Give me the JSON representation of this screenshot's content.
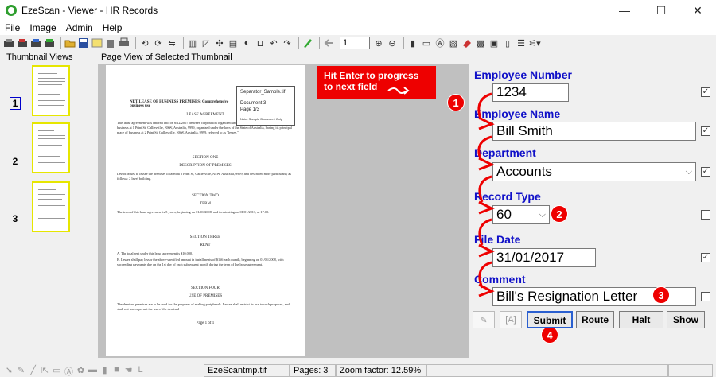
{
  "window": {
    "title": "EzeScan - Viewer - HR Records",
    "minimize": "—",
    "maximize": "☐",
    "close": "✕"
  },
  "menu": [
    "File",
    "Image",
    "Admin",
    "Help"
  ],
  "toolbar": {
    "page_number": "1"
  },
  "thumbnails": {
    "title": "Thumbnail Views",
    "pages": [
      "1",
      "2",
      "3"
    ],
    "selected": "1"
  },
  "page_view": {
    "title": "Page View of Selected Thumbnail",
    "separator": {
      "filename": "Separator_Sample.tif",
      "line1": "Document 3",
      "line2": "Page 1/3",
      "line3": "Note: Sample Document Only"
    },
    "doc": {
      "heading": "NET LEASE OF BUSINESS PREMISES: Comprehensive business use",
      "lease_agreement": "LEASE AGREEMENT",
      "intro": "This lease agreement was entered into on 6/12/2007 between corporation organized under the laws of the State of Austria of business at 1 Print St, Calliesville, NSW, Australia, 9999, organized under the laws of the State of Australia, having its principal place of business at 2 Print St, Calliesville, NSW, Australia, 9999, referred to as \"lessee.\"",
      "section_one": "SECTION ONE",
      "desc_premises": "DESCRIPTION OF PREMISES",
      "desc_text": "Lessor leases to lessee the premises located at 2 Print St, Calliesville, NSW, Australia, 9999, and described more particularly as follows: 2 level building.",
      "section_two": "SECTION TWO",
      "term": "TERM",
      "term_text": "The term of this lease agreement is 5 years, beginning on 01/01/2008, and terminating on 01/01/2013, at 17:00.",
      "section_three": "SECTION THREE",
      "rent": "RENT",
      "rent_a": "A. The total rent under this lease agreement is $10,000.",
      "rent_b": "B. Lessee shall pay lessor the above-specified amount in installments of $166 each month, beginning on 01/01/2008, with succeeding payments due on the 1st day of each subsequent month during the term of the lease agreement.",
      "section_four": "SECTION FOUR",
      "use": "USE OF PREMISES",
      "use_text": "The demised premises are to be used for the purposes of making peripherals. Lessee shall restrict its use to such purposes, and shall not use or permit the use of the demised",
      "page_footer": "Page 1 of 1"
    }
  },
  "callout": {
    "text_line1": "Hit Enter to progress",
    "text_line2": "to next field"
  },
  "form": {
    "employee_number": {
      "label": "Employee Number",
      "value": "1234"
    },
    "employee_name": {
      "label": "Employee Name",
      "value": "Bill Smith"
    },
    "department": {
      "label": "Department",
      "value": "Accounts"
    },
    "record_type": {
      "label": "Record Type",
      "value": "60"
    },
    "file_date": {
      "label": "File Date",
      "value": "31/01/2017"
    },
    "comment": {
      "label": "Comment",
      "value": "Bill's Resignation Letter"
    },
    "buttons": {
      "submit": "Submit",
      "route": "Route",
      "halt": "Halt",
      "show": "Show"
    },
    "badges": [
      "1",
      "2",
      "3",
      "4"
    ]
  },
  "statusbar": {
    "file": "EzeScantmp.tif",
    "pages": "Pages: 3",
    "zoom": "Zoom factor: 12.59%"
  },
  "colors": {
    "label_blue": "#1010c8",
    "annotation_red": "#e00000",
    "thumb_highlight": "#e6e600"
  }
}
